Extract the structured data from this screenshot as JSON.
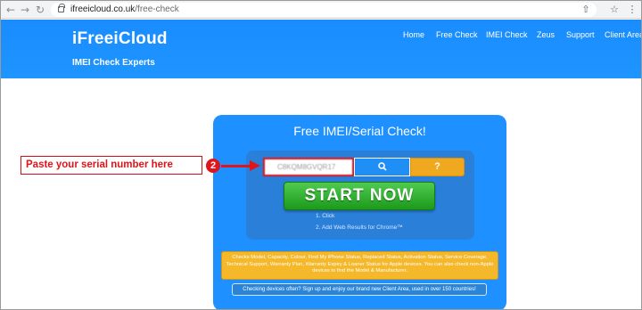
{
  "browser": {
    "url_domain": "ifreeicloud.co.uk",
    "url_path": "/free-check",
    "back_icon": "←",
    "forward_icon": "→",
    "reload_icon": "↻",
    "share_icon": "⇧",
    "star_icon": "☆",
    "menu_icon": "⋮"
  },
  "header": {
    "logo": "iFreeiCloud",
    "tagline": "IMEI Check Experts",
    "nav": [
      "Home",
      "Free Check",
      "IMEI Check",
      "Zeus",
      "Support",
      "Client Area"
    ]
  },
  "card": {
    "title": "Free IMEI/Serial Check!",
    "serial_value": "C8KQM8GVQR17",
    "search_icon": "🔍",
    "help_label": "?",
    "start_label": "START NOW",
    "steps": [
      "1. Click",
      "2. Add Web Results for Chrome™"
    ],
    "info_text": "Checks Model, Capacity, Colour, Find My iPhone Status, Replaced Status, Activation Status, Service Coverage, Technical Support, Warranty Plan, Warranty Expiry & Loaner Status for Apple devices. You can also check non-Apple devices to find the Model & Manufacturer.",
    "client_text": "Checking devices often? Sign up and enjoy our brand new Client Area, used in over 150 countries!"
  },
  "annotation": {
    "label": "Paste your serial number here",
    "step_number": "2",
    "color": "#e0141b"
  },
  "colors": {
    "header_blue": "#1a8cff",
    "card_blue": "#1e90ff",
    "start_green": "#2db52d",
    "help_orange": "#f0a91e"
  }
}
